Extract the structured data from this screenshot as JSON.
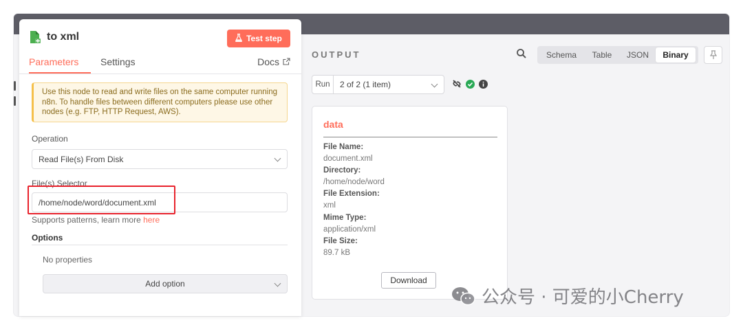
{
  "node": {
    "title": "to xml",
    "test_button_label": "Test step",
    "tabs": [
      {
        "label": "Parameters",
        "active": true
      },
      {
        "label": "Settings",
        "active": false
      }
    ],
    "docs_label": "Docs"
  },
  "notice": {
    "text": "Use this node to read and write files on the same computer running n8n. To handle files between different computers please use other nodes (e.g. FTP, HTTP Request, AWS)."
  },
  "fields": {
    "operation_label": "Operation",
    "operation_value": "Read File(s) From Disk",
    "selector_label": "File(s) Selector",
    "selector_value": "/home/node/word/document.xml",
    "hint_text": "Supports patterns, learn more ",
    "hint_link": "here",
    "options_label": "Options",
    "no_properties": "No properties",
    "add_option_label": "Add option"
  },
  "output": {
    "title": "OUTPUT",
    "views": [
      {
        "label": "Schema",
        "active": false
      },
      {
        "label": "Table",
        "active": false
      },
      {
        "label": "JSON",
        "active": false
      },
      {
        "label": "Binary",
        "active": true
      }
    ],
    "run_label": "Run",
    "run_value": "2 of 2 (1 item)"
  },
  "binary": {
    "title": "data",
    "fields": [
      {
        "key": "File Name:",
        "value": "document.xml"
      },
      {
        "key": "Directory:",
        "value": "/home/node/word"
      },
      {
        "key": "File Extension:",
        "value": "xml"
      },
      {
        "key": "Mime Type:",
        "value": "application/xml"
      },
      {
        "key": "File Size:",
        "value": "89.7 kB"
      }
    ],
    "download_label": "Download"
  },
  "watermark": {
    "text": "公众号 · 可爱的小Cherry"
  },
  "colors": {
    "accent": "#ff6d5a",
    "success": "#29a855",
    "highlight": "#e8212b",
    "topbar": "#5d5d66"
  }
}
